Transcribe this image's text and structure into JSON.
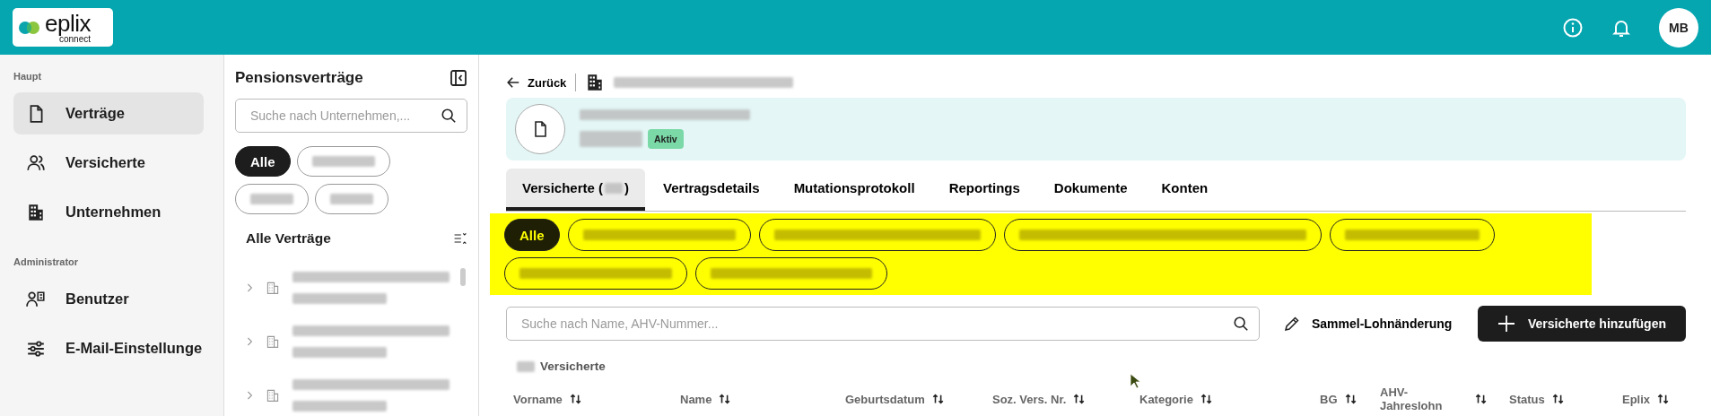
{
  "header": {
    "logo": {
      "name": "eplix",
      "sub": "connect"
    },
    "avatar": "MB"
  },
  "sidebar": {
    "sections": [
      {
        "title": "Haupt",
        "items": [
          {
            "label": "Verträge",
            "kind": "document",
            "selected": true
          },
          {
            "label": "Versicherte",
            "kind": "users",
            "selected": false
          },
          {
            "label": "Unternehmen",
            "kind": "building",
            "selected": false
          }
        ]
      },
      {
        "title": "Administrator",
        "items": [
          {
            "label": "Benutzer",
            "kind": "user-admin",
            "selected": false
          },
          {
            "label": "E-Mail-Einstellunge",
            "kind": "sliders",
            "selected": false
          }
        ]
      }
    ]
  },
  "contracts_panel": {
    "title": "Pensionsverträge",
    "search": {
      "placeholder": "Suche nach Unternehmen,..."
    },
    "filters": [
      {
        "label": "Alle",
        "selected": true
      },
      {
        "kind": "redacted",
        "selected": false
      },
      {
        "kind": "redacted",
        "selected": false
      },
      {
        "kind": "redacted",
        "selected": false
      }
    ],
    "list_title": "Alle Verträge",
    "items": [
      {
        "kind": "redacted"
      },
      {
        "kind": "redacted"
      },
      {
        "kind": "redacted"
      }
    ]
  },
  "main": {
    "back": "Zurück",
    "breadcrumb": {
      "kind": "redacted"
    },
    "contract_card": {
      "status": "Aktiv"
    },
    "tabs": [
      {
        "label": "Versicherte (",
        "suffix": ")",
        "kind": "redacted",
        "selected": true
      },
      {
        "label": "Vertragsdetails",
        "selected": false
      },
      {
        "label": "Mutationsprotokoll",
        "selected": false
      },
      {
        "label": "Reportings",
        "selected": false
      },
      {
        "label": "Dokumente",
        "selected": false
      },
      {
        "label": "Konten",
        "selected": false
      }
    ],
    "categories": [
      {
        "label": "Alle",
        "selected": true
      },
      {
        "kind": "redacted",
        "selected": false
      },
      {
        "kind": "redacted",
        "selected": false
      },
      {
        "kind": "redacted",
        "selected": false
      },
      {
        "kind": "redacted",
        "selected": false
      },
      {
        "kind": "redacted",
        "selected": false
      },
      {
        "kind": "redacted",
        "selected": false
      }
    ],
    "search": {
      "placeholder": "Suche nach Name, AHV-Nummer..."
    },
    "bulk_button": "Sammel-Lohnänderung",
    "add_button": "Versicherte hinzufügen",
    "count_label": "Versicherte",
    "table": {
      "columns": [
        "Vorname",
        "Name",
        "Geburtsdatum",
        "Soz. Vers. Nr.",
        "Kategorie",
        "BG",
        "AHV-Jahreslohn",
        "Status",
        "Eplix"
      ]
    }
  }
}
